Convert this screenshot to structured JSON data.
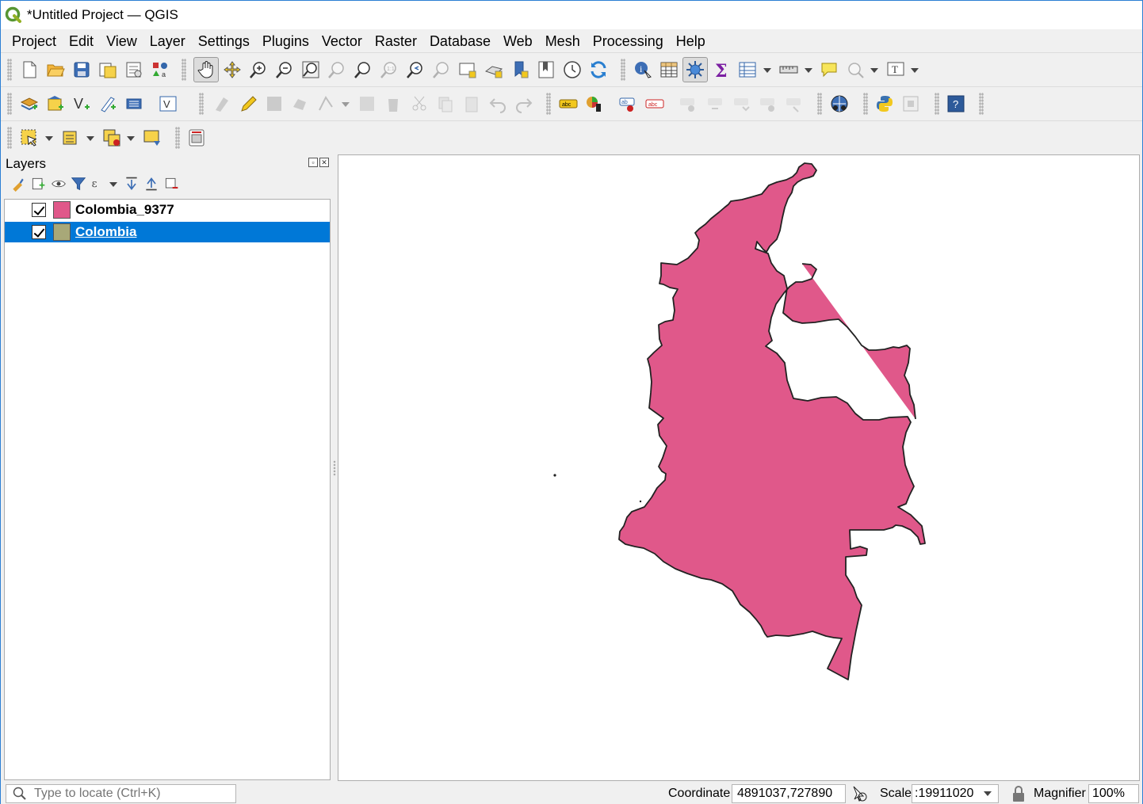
{
  "window": {
    "title": "*Untitled Project — QGIS"
  },
  "menubar": {
    "items": [
      "Project",
      "Edit",
      "View",
      "Layer",
      "Settings",
      "Plugins",
      "Vector",
      "Raster",
      "Database",
      "Web",
      "Mesh",
      "Processing",
      "Help"
    ]
  },
  "toolbars": {
    "file": [
      "new-project-icon",
      "open-project-icon",
      "save-project-icon",
      "save-as-icon",
      "print-layout-icon",
      "style-manager-icon"
    ],
    "navigation": [
      "pan-icon",
      "pan-to-selection-icon",
      "zoom-in-icon",
      "zoom-out-icon",
      "zoom-full-icon",
      "zoom-selection-icon",
      "zoom-layer-icon",
      "zoom-native-icon",
      "zoom-last-icon",
      "zoom-next-icon",
      "new-map-view-icon",
      "new-3d-view-icon",
      "bookmark-icon",
      "show-bookmarks-icon",
      "temporal-icon",
      "refresh-icon"
    ],
    "attributes": [
      "identify-icon",
      "open-attribute-table-icon",
      "toggle-editing-settings-icon",
      "statistics-icon",
      "field-calculator-icon",
      "measure-icon",
      "map-tips-icon",
      "select-location-icon",
      "text-annotation-icon"
    ],
    "layers": [
      "add-layer-icon",
      "add-new-layer-icon",
      "add-vector-icon",
      "new-shapefile-icon",
      "digitize-icon",
      "virtual-layer-icon"
    ],
    "digitizing": [
      "current-edits-icon",
      "toggle-editing-icon",
      "save-edits-icon",
      "add-feature-icon",
      "vertex-tool-icon",
      "modify-attributes-icon",
      "delete-icon",
      "cut-icon",
      "copy-icon",
      "paste-icon",
      "undo-icon",
      "redo-icon"
    ],
    "labels": [
      "label-icon",
      "diagram-icon",
      "pin-label-icon",
      "highlight-label-icon",
      "show-hide-label-icon",
      "move-label-icon",
      "rotate-label-icon",
      "change-label-icon",
      "label-options-icon"
    ],
    "plugins": [
      "georeferencer-icon",
      "python-console-icon",
      "plugin-manager-icon",
      "help-icon"
    ],
    "selection": [
      "select-features-icon",
      "select-by-value-icon",
      "deselect-icon",
      "select-by-expression-icon",
      "printer-icon"
    ]
  },
  "layers_panel": {
    "title": "Layers",
    "tools": [
      "open-styling-icon",
      "add-group-icon",
      "manage-visibility-icon",
      "filter-legend-icon",
      "filter-expression-icon",
      "expand-all-icon",
      "collapse-all-icon",
      "remove-layer-icon"
    ],
    "layers": [
      {
        "name": "Colombia_9377",
        "color": "#e0588a",
        "checked": true,
        "selected": false
      },
      {
        "name": "Colombia",
        "color": "#a8a878",
        "checked": true,
        "selected": true
      }
    ]
  },
  "map": {
    "fill": "#e0588a",
    "stroke": "#222222"
  },
  "statusbar": {
    "locator_placeholder": "Type to locate (Ctrl+K)",
    "coordinate_label": "Coordinate",
    "coordinate_value": "4891037,727890",
    "scale_label": "Scale",
    "scale_value": ":19911020",
    "magnifier_label": "Magnifier",
    "magnifier_value": "100%"
  }
}
